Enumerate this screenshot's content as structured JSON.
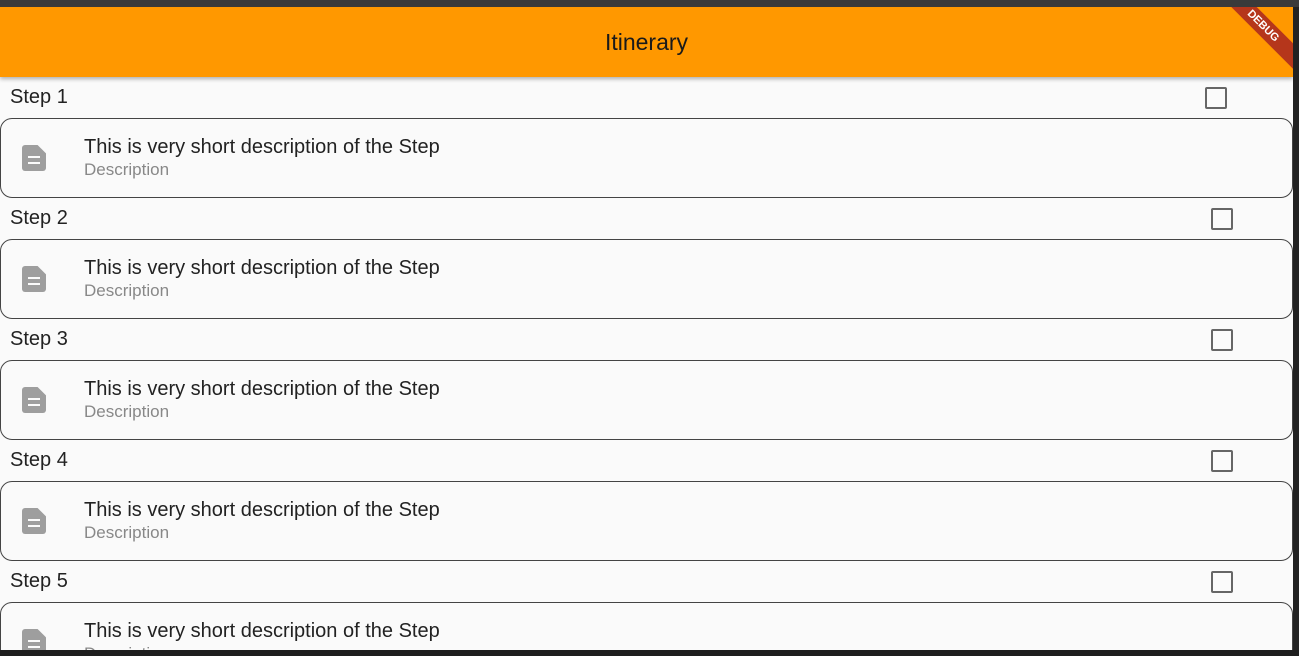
{
  "app_bar": {
    "title": "Itinerary",
    "debug_banner": "DEBUG",
    "color": "#ff9800"
  },
  "steps": [
    {
      "title": "Step 1",
      "checked": false,
      "text": "This is very short description of the Step",
      "subtitle": "Description"
    },
    {
      "title": "Step 2",
      "checked": false,
      "text": "This is very short description of the Step",
      "subtitle": "Description"
    },
    {
      "title": "Step 3",
      "checked": false,
      "text": "This is very short description of the Step",
      "subtitle": "Description"
    },
    {
      "title": "Step 4",
      "checked": false,
      "text": "This is very short description of the Step",
      "subtitle": "Description"
    },
    {
      "title": "Step 5",
      "checked": false,
      "text": "This is very short description of the Step",
      "subtitle": "Description"
    }
  ]
}
